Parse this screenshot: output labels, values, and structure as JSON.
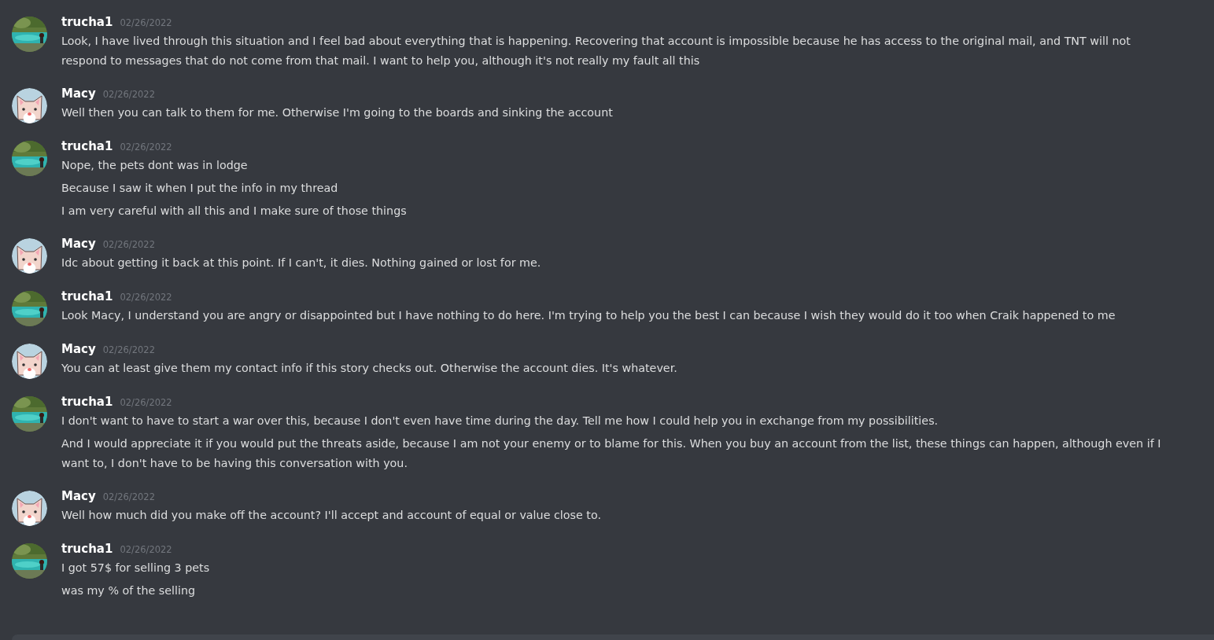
{
  "messages": [
    {
      "author": "trucha1",
      "time": "02/26/2022",
      "lines": [
        "Look, I have lived through this situation and I feel bad about everything that is happening. Recovering that account is impossible because he has access to the original mail, and TNT will not respond to messages that do not come from that mail. I want to help you, although it's not really my fault all this"
      ]
    },
    {
      "author": "Macy",
      "kind": "cat",
      "time": "02/26/2022",
      "lines": [
        "Well then you can talk to them for me. Otherwise I'm going to the boards and sinking the account"
      ]
    },
    {
      "author": "trucha1",
      "time": "02/26/2022",
      "lines": [
        "Nope, the pets dont was in lodge",
        "Because I saw it when I put the info in my thread",
        "I am very careful with all this and I make sure of those things"
      ]
    },
    {
      "author": "Macy",
      "kind": "cat",
      "time": "02/26/2022",
      "lines": [
        "Idc about getting it back at this point. If I can't, it dies. Nothing gained or lost for me."
      ]
    },
    {
      "author": "trucha1",
      "time": "02/26/2022",
      "lines": [
        "Look Macy, I understand you are angry or disappointed but I have nothing to do here. I'm trying to help you the best I can because I wish they would do it too when Craik happened to me"
      ]
    },
    {
      "author": "Macy",
      "kind": "cat",
      "time": "02/26/2022",
      "lines": [
        "You can at least give them my contact info if this story checks out. Otherwise the account dies. It's whatever."
      ]
    },
    {
      "author": "trucha1",
      "time": "02/26/2022",
      "lines": [
        "I don't want to have to start a war over this, because I don't even have time during the day. Tell me how I could help you in exchange from my possibilities.",
        "And I would appreciate it if you would put the threats aside, because I am not your enemy or to blame for this. When you buy an account from the list, these things can happen, although even if I want to, I don't have to be having this conversation with you."
      ]
    },
    {
      "author": "Macy",
      "kind": "cat",
      "time": "02/26/2022",
      "lines": [
        "Well how much did you make off the account? I'll accept and account of equal or value close to."
      ]
    },
    {
      "author": "trucha1",
      "time": "02/26/2022",
      "lines": [
        "I got 57$ for selling 3 pets",
        "was my % of the selling"
      ]
    }
  ]
}
